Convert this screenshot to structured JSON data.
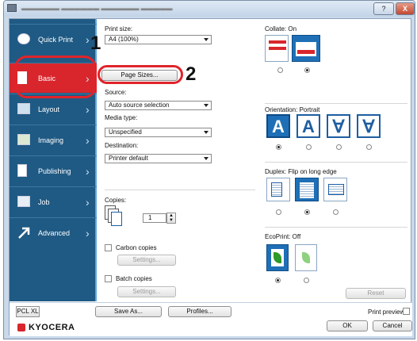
{
  "window": {
    "help_label": "?",
    "close_label": "X"
  },
  "sidebar": {
    "items": [
      {
        "label": "Quick Print",
        "icon": "quick-print-icon"
      },
      {
        "label": "Basic",
        "icon": "basic-icon",
        "active": true
      },
      {
        "label": "Layout",
        "icon": "layout-icon"
      },
      {
        "label": "Imaging",
        "icon": "imaging-icon"
      },
      {
        "label": "Publishing",
        "icon": "publishing-icon"
      },
      {
        "label": "Job",
        "icon": "job-icon"
      },
      {
        "label": "Advanced",
        "icon": "advanced-icon"
      }
    ]
  },
  "callouts": {
    "one": "1",
    "two": "2"
  },
  "basic": {
    "print_size_label": "Print size:",
    "print_size_value": "A4 (100%)",
    "page_sizes_button": "Page Sizes...",
    "source_label": "Source:",
    "source_value": "Auto source selection",
    "media_type_label": "Media type:",
    "media_type_value": "Unspecified",
    "destination_label": "Destination:",
    "destination_value": "Printer default",
    "copies_label": "Copies:",
    "copies_value": "1",
    "carbon_copies_label": "Carbon copies",
    "carbon_settings_button": "Settings...",
    "batch_copies_label": "Batch copies",
    "batch_settings_button": "Settings..."
  },
  "right": {
    "collate_label": "Collate:  On",
    "orientation_label": "Orientation:  Portrait",
    "duplex_label": "Duplex:  Flip on long edge",
    "ecoprint_label": "EcoPrint:  Off",
    "orientation_glyphs": [
      "A",
      "A",
      "∀",
      "∀"
    ],
    "reset_button": "Reset"
  },
  "footer": {
    "pcl_label": "PCL XL",
    "save_as_button": "Save As...",
    "profiles_button": "Profiles...",
    "print_preview_label": "Print preview",
    "brand": "KYOCERA",
    "ok_button": "OK",
    "cancel_button": "Cancel"
  },
  "colors": {
    "sidebar_bg": "#1f5a84",
    "active_bg": "#d8262c",
    "accent": "#1e6fb6",
    "callout": "#e0242b"
  }
}
